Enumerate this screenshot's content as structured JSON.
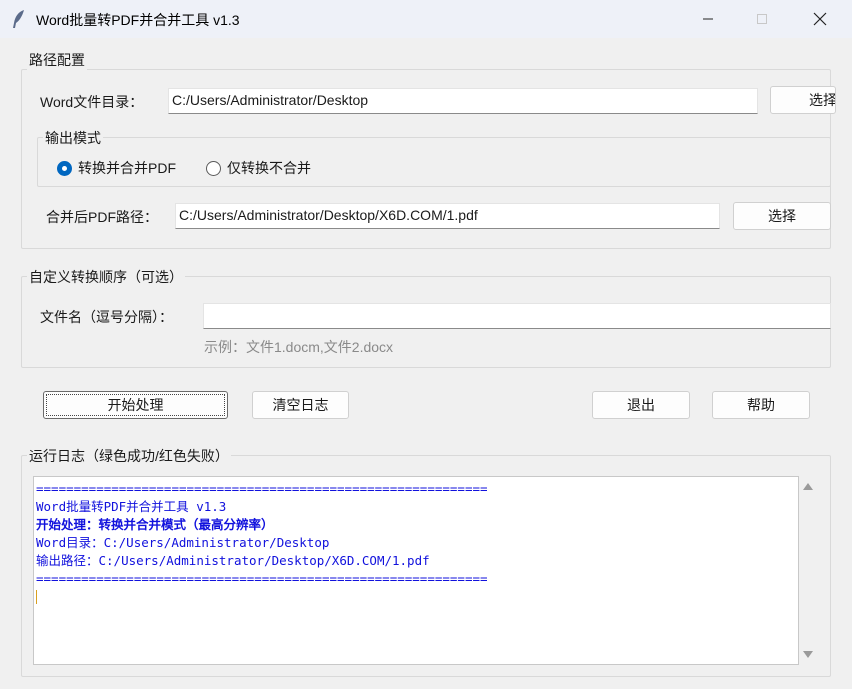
{
  "window": {
    "title": "Word批量转PDF并合并工具 v1.3"
  },
  "path_config": {
    "group_label": "路径配置",
    "word_dir_label": "Word文件目录：",
    "word_dir_value": "C:/Users/Administrator/Desktop",
    "word_dir_button": "选择",
    "output_mode_label": "输出模式",
    "mode_options": [
      "转换并合并PDF",
      "仅转换不合并"
    ],
    "selected_mode": "转换并合并PDF",
    "merged_path_label": "合并后PDF路径：",
    "merged_path_value": "C:/Users/Administrator/Desktop/X6D.COM/1.pdf",
    "merged_path_button": "选择"
  },
  "custom_order": {
    "group_label": "自定义转换顺序（可选）",
    "filename_label": "文件名（逗号分隔）：",
    "filename_value": "",
    "example_hint": "示例：文件1.docm,文件2.docx"
  },
  "actions": {
    "start": "开始处理",
    "clear_log": "清空日志",
    "exit": "退出",
    "help": "帮助"
  },
  "log": {
    "group_label": "运行日志（绿色成功/红色失败）",
    "lines": [
      "============================================================",
      "Word批量转PDF并合并工具 v1.3",
      "开始处理：转换并合并模式（最高分辨率）",
      "Word目录：C:/Users/Administrator/Desktop",
      "输出路径：C:/Users/Administrator/Desktop/X6D.COM/1.pdf",
      "============================================================"
    ]
  },
  "colors": {
    "log_text": "#1111dd",
    "accent": "#0067c0"
  }
}
